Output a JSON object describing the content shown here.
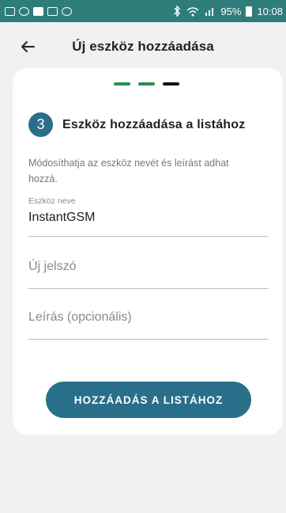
{
  "status_bar": {
    "time": "10:08",
    "battery": "95%",
    "icons": [
      "gallery-icon",
      "transfer-icon",
      "image-icon",
      "image-icon",
      "podcast-icon"
    ],
    "right_icons": [
      "bluetooth-icon",
      "wifi-icon",
      "signal-icon",
      "battery-icon"
    ]
  },
  "appbar": {
    "title": "Új eszköz hozzáadása",
    "back_icon": "back-arrow-icon"
  },
  "progress": {
    "segments": [
      "#2e8b57",
      "#2e8b57",
      "#111111"
    ]
  },
  "step": {
    "number": "3",
    "title": "Eszköz hozzáadása a listához"
  },
  "description": "Módosíthatja az eszköz nevét és leírást adhat hozzá.",
  "fields": {
    "device_name": {
      "label": "Eszköz neve",
      "value": "InstantGSM"
    },
    "new_password": {
      "placeholder": "Új jelszó"
    },
    "description": {
      "placeholder": "Leírás (opcionális)"
    }
  },
  "add_button": {
    "label": "HOZZÁADÁS A LISTÁHOZ"
  },
  "colors": {
    "status_bar": "#2e7d79",
    "accent": "#2a6f8a",
    "progress_done": "#2e8b57",
    "progress_current": "#111111"
  }
}
